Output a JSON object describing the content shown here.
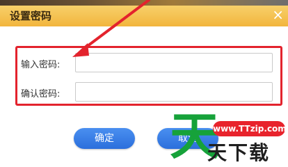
{
  "dialog": {
    "title": "设置密码",
    "close_glyph": "×"
  },
  "form": {
    "password_label": "输入密码:",
    "confirm_label": "确认密码:",
    "password_value": "",
    "confirm_value": ""
  },
  "buttons": {
    "ok_label": "确定",
    "cancel_label": "取消"
  },
  "annotation": {
    "color": "#e3232d"
  },
  "watermark": {
    "url": "www.TTzip.com",
    "big_char": "天",
    "chars": "天下载"
  }
}
